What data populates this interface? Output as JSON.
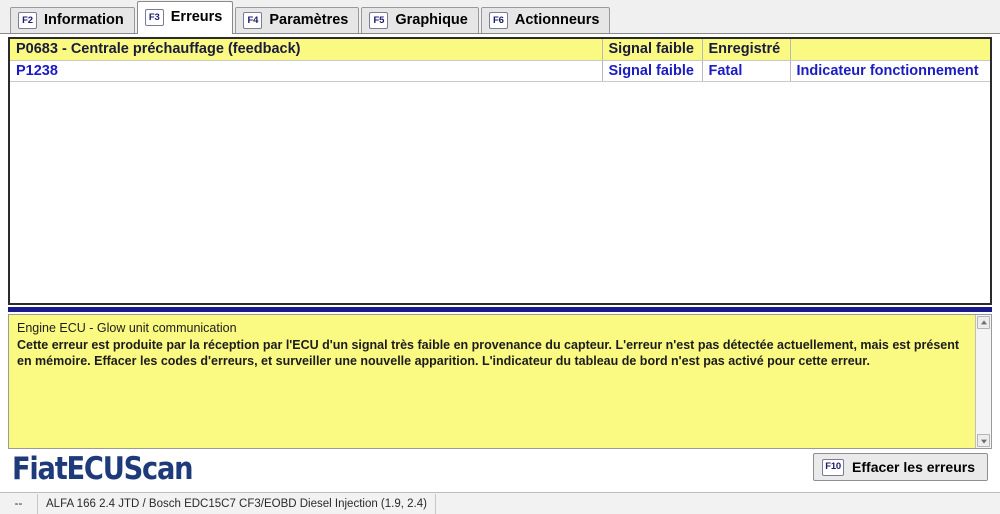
{
  "tabs": [
    {
      "key": "F2",
      "label": "Information",
      "active": false
    },
    {
      "key": "F3",
      "label": "Erreurs",
      "active": true
    },
    {
      "key": "F4",
      "label": "Paramètres",
      "active": false
    },
    {
      "key": "F5",
      "label": "Graphique",
      "active": false
    },
    {
      "key": "F6",
      "label": "Actionneurs",
      "active": false
    }
  ],
  "error_table": {
    "columns": [
      "code",
      "signal",
      "state",
      "indicator"
    ],
    "rows": [
      {
        "code": "P0683 - Centrale préchauffage (feedback)",
        "signal": "Signal faible",
        "state": "Enregistré",
        "indicator": "",
        "selected": true
      },
      {
        "code": "P1238",
        "signal": "Signal faible",
        "state": "Fatal",
        "indicator": "Indicateur fonctionnement",
        "selected": false
      }
    ]
  },
  "description": {
    "title": "Engine ECU - Glow unit communication",
    "text": "Cette erreur est produite par la réception par l'ECU d'un signal très faible en provenance du capteur. L'erreur n'est pas détectée actuellement, mais est présent en mémoire. Effacer les codes d'erreurs, et surveiller une nouvelle apparition. L'indicateur du tableau de bord n'est pas activé pour cette erreur."
  },
  "footer": {
    "logo": "FiatECUScan",
    "clear_button": {
      "key": "F10",
      "label": "Effacer les erreurs"
    }
  },
  "statusbar": {
    "left": "--",
    "vehicle": "ALFA 166 2.4 JTD / Bosch EDC15C7 CF3/EOBD Diesel Injection (1.9, 2.4)"
  },
  "colors": {
    "highlight_yellow": "#fafa82",
    "link_blue": "#1b1bc4",
    "separator_navy": "#1a1a8c",
    "logo_navy": "#1f3a7a"
  }
}
